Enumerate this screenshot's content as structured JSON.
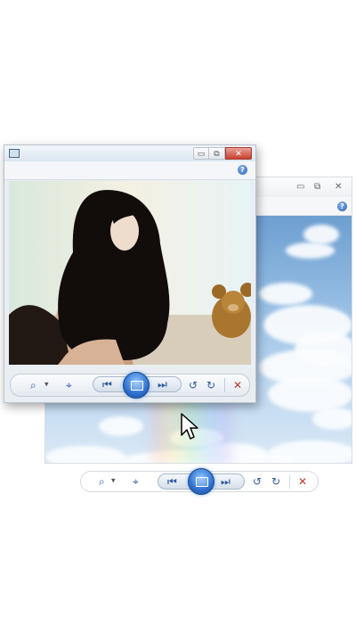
{
  "back_window": {
    "controls": {
      "minimize": "▭",
      "maximize": "⧉",
      "close": "✕"
    },
    "help": "?"
  },
  "front_window": {
    "controls": {
      "minimize": "▭",
      "maximize": "⧉",
      "close": "✕"
    },
    "help": "?"
  },
  "toolbar": {
    "zoom_icon": "zoom-icon",
    "fit_icon": "actual-size-icon",
    "prev_icon": "previous-icon",
    "slideshow_icon": "slideshow-icon",
    "next_icon": "next-icon",
    "rotate_ccw_icon": "rotate-counterclockwise-icon",
    "rotate_cw_icon": "rotate-clockwise-icon",
    "delete_icon": "delete-icon"
  },
  "colors": {
    "accent_blue": "#2f6fcf",
    "close_red": "#c7412f",
    "delete_red": "#c0392b"
  }
}
